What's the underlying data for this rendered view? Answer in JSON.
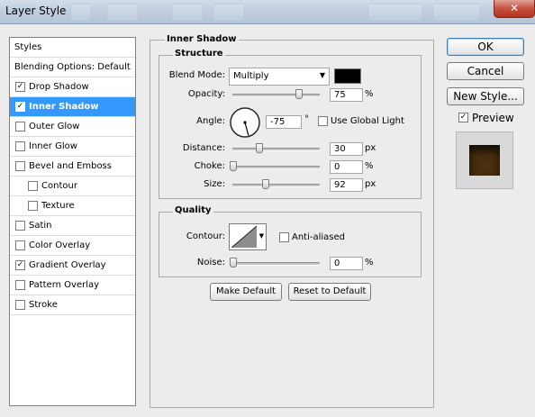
{
  "window": {
    "title": "Layer Style"
  },
  "styles_list": {
    "header": "Styles",
    "blending": "Blending Options: Default",
    "items": [
      {
        "label": "Drop Shadow",
        "checked": true,
        "selected": false,
        "indent": false
      },
      {
        "label": "Inner Shadow",
        "checked": true,
        "selected": true,
        "indent": false
      },
      {
        "label": "Outer Glow",
        "checked": false,
        "selected": false,
        "indent": false
      },
      {
        "label": "Inner Glow",
        "checked": false,
        "selected": false,
        "indent": false
      },
      {
        "label": "Bevel and Emboss",
        "checked": false,
        "selected": false,
        "indent": false
      },
      {
        "label": "Contour",
        "checked": false,
        "selected": false,
        "indent": true
      },
      {
        "label": "Texture",
        "checked": false,
        "selected": false,
        "indent": true
      },
      {
        "label": "Satin",
        "checked": false,
        "selected": false,
        "indent": false
      },
      {
        "label": "Color Overlay",
        "checked": false,
        "selected": false,
        "indent": false
      },
      {
        "label": "Gradient Overlay",
        "checked": true,
        "selected": false,
        "indent": false
      },
      {
        "label": "Pattern Overlay",
        "checked": false,
        "selected": false,
        "indent": false
      },
      {
        "label": "Stroke",
        "checked": false,
        "selected": false,
        "indent": false
      }
    ]
  },
  "inner_shadow": {
    "section_title": "Inner Shadow",
    "structure": {
      "title": "Structure",
      "blend_mode_label": "Blend Mode:",
      "blend_mode_value": "Multiply",
      "shadow_color": "#000000",
      "opacity_label": "Opacity:",
      "opacity_value": "75",
      "opacity_unit": "%",
      "opacity_level": 75,
      "angle_label": "Angle:",
      "angle_value": "-75",
      "angle_unit": "°",
      "use_global_light_label": "Use Global Light",
      "use_global_light_checked": false,
      "distance_label": "Distance:",
      "distance_value": "30",
      "distance_unit": "px",
      "distance_level": 30,
      "choke_label": "Choke:",
      "choke_value": "0",
      "choke_unit": "%",
      "choke_level": 0,
      "size_label": "Size:",
      "size_value": "92",
      "size_unit": "px",
      "size_level": 37
    },
    "quality": {
      "title": "Quality",
      "contour_label": "Contour:",
      "anti_aliased_label": "Anti-aliased",
      "anti_aliased_checked": false,
      "noise_label": "Noise:",
      "noise_value": "0",
      "noise_unit": "%",
      "noise_level": 0
    },
    "make_default_label": "Make Default",
    "reset_default_label": "Reset to Default"
  },
  "actions": {
    "ok_label": "OK",
    "cancel_label": "Cancel",
    "new_style_label": "New Style...",
    "preview_label": "Preview",
    "preview_checked": true
  },
  "colors": {
    "selection": "#3399ff",
    "preview_swatch": "#4a2f10"
  }
}
